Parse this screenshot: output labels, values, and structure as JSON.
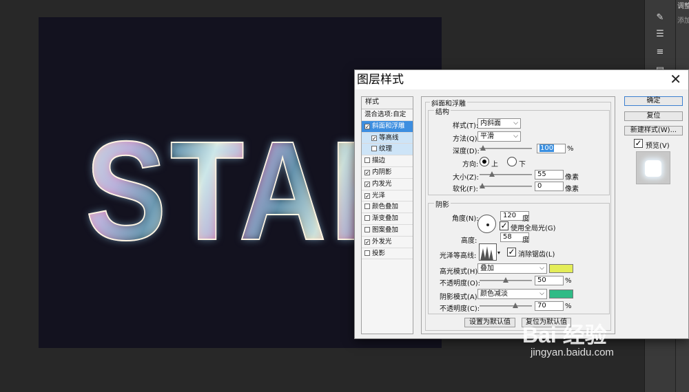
{
  "workspace": {
    "doc_bg": "#13121f",
    "artwork_text": "STAR",
    "right_panel_labels": [
      "调整",
      "添加"
    ]
  },
  "dialog": {
    "title": "图层样式",
    "styles_header": "样式",
    "blend_options": "混合选项:自定",
    "style_items": [
      {
        "label": "斜面和浮雕",
        "checked": true,
        "selected": true,
        "sub": false
      },
      {
        "label": "等高线",
        "checked": true,
        "selected": false,
        "sub": true
      },
      {
        "label": "纹理",
        "checked": false,
        "selected": false,
        "sub": true
      },
      {
        "label": "描边",
        "checked": false,
        "selected": false,
        "sub": false
      },
      {
        "label": "内阴影",
        "checked": true,
        "selected": false,
        "sub": false
      },
      {
        "label": "内发光",
        "checked": true,
        "selected": false,
        "sub": false
      },
      {
        "label": "光泽",
        "checked": true,
        "selected": false,
        "sub": false
      },
      {
        "label": "颜色叠加",
        "checked": false,
        "selected": false,
        "sub": false
      },
      {
        "label": "渐变叠加",
        "checked": false,
        "selected": false,
        "sub": false
      },
      {
        "label": "图案叠加",
        "checked": false,
        "selected": false,
        "sub": false
      },
      {
        "label": "外发光",
        "checked": true,
        "selected": false,
        "sub": false
      },
      {
        "label": "投影",
        "checked": false,
        "selected": false,
        "sub": false
      }
    ],
    "bevel": {
      "section": "斜面和浮雕",
      "structure": "结构",
      "style_label": "样式(T):",
      "style_value": "内斜面",
      "technique_label": "方法(Q):",
      "technique_value": "平滑",
      "depth_label": "深度(D):",
      "depth_value": "100",
      "depth_pct": 0.02,
      "depth_unit": "%",
      "direction_label": "方向:",
      "dir_up": "上",
      "dir_down": "下",
      "size_label": "大小(Z):",
      "size_value": "55",
      "size_pct": 0.2,
      "size_unit": "像素",
      "soften_label": "软化(F):",
      "soften_value": "0",
      "soften_pct": 0.0,
      "soften_unit": "像素"
    },
    "shading": {
      "section": "阴影",
      "angle_label": "角度(N):",
      "angle_value": "120",
      "angle_unit": "度",
      "global_light_label": "使用全局光(G)",
      "global_light_checked": true,
      "altitude_label": "高度:",
      "altitude_value": "58",
      "altitude_unit": "度",
      "gloss_label": "光泽等高线:",
      "antialias_label": "消除锯齿(L)",
      "antialias_checked": true,
      "highlight_mode_label": "高光模式(H):",
      "highlight_mode_value": "叠加",
      "highlight_color": "#e4ed58",
      "highlight_opacity_label": "不透明度(O):",
      "highlight_opacity_value": "50",
      "highlight_opacity_pct": 0.5,
      "shadow_mode_label": "阴影模式(A):",
      "shadow_mode_value": "颜色减淡",
      "shadow_color": "#2fbb86",
      "shadow_opacity_label": "不透明度(C):",
      "shadow_opacity_value": "70",
      "shadow_opacity_pct": 0.7,
      "pct_unit": "%"
    },
    "make_default": "设置为默认值",
    "reset_default": "复位为默认值",
    "ok": "确定",
    "reset": "复位",
    "new_style": "新建样式(W)...",
    "preview_label": "预览(V)",
    "preview_checked": true
  },
  "watermark": {
    "brand": "Bai 经验",
    "url": "jingyan.baidu.com"
  }
}
